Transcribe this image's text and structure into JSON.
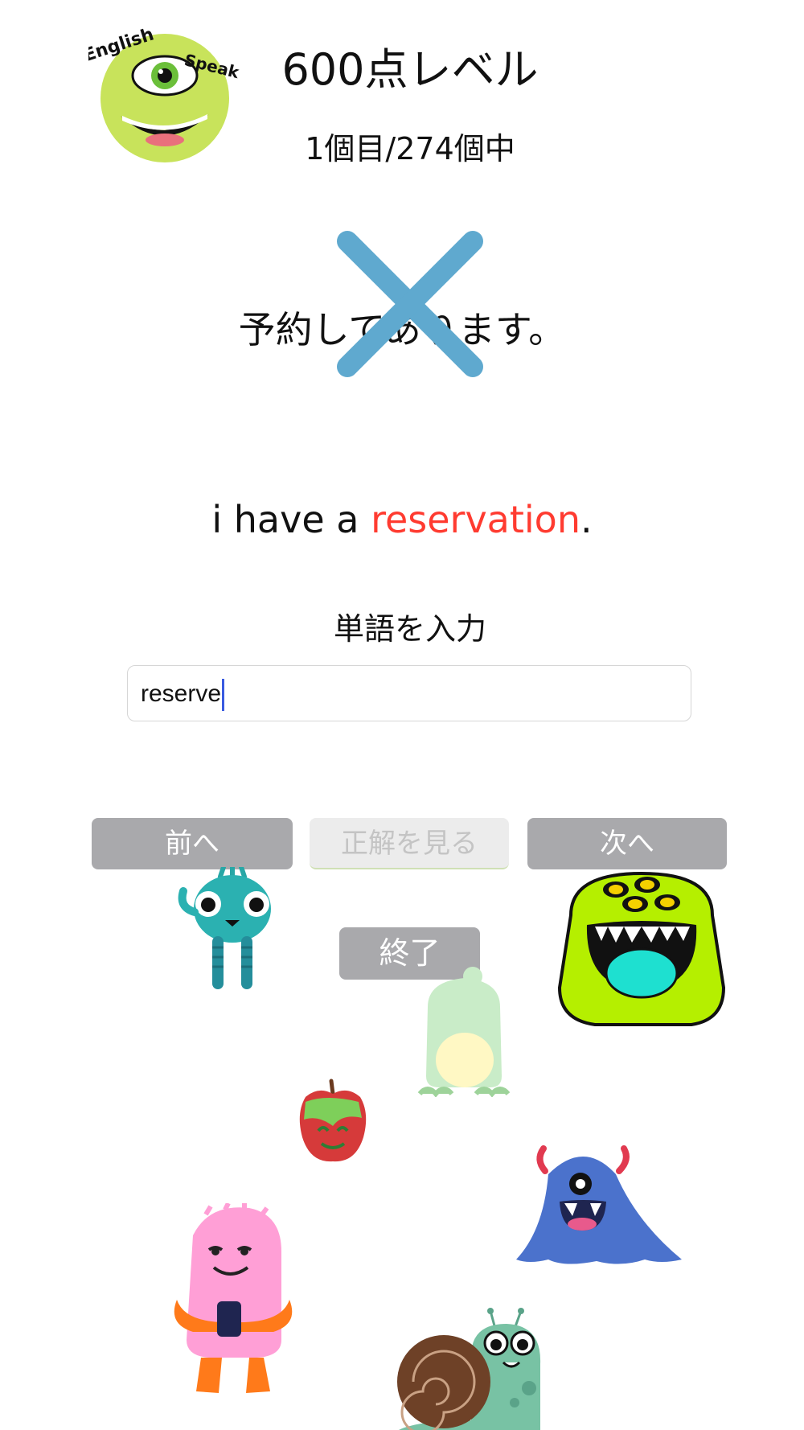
{
  "header": {
    "logo": {
      "text_top": "English",
      "text_right": "Speak"
    },
    "title": "600点レベル",
    "counter": "1個目/274個中"
  },
  "quiz": {
    "japanese_prompt": "予約してあります。",
    "result_mark": "x-icon",
    "sentence_prefix": "i have a ",
    "sentence_answer": "reservation",
    "sentence_suffix": ".",
    "input_label": "単語を入力",
    "input_value": "reserve"
  },
  "buttons": {
    "prev": "前へ",
    "show_answer": "正解を見る",
    "next": "次へ",
    "quit": "終了"
  },
  "colors": {
    "answer_highlight": "#ff3b30",
    "x_mark": "#5fa9cf",
    "button_gray": "#a9a9ac",
    "caret": "#3a5be0"
  },
  "decorations": [
    "teal-monster-icon",
    "lime-monster-icon",
    "frog-icon",
    "poison-apple-icon",
    "blue-monster-icon",
    "pink-monster-icon",
    "snail-icon"
  ]
}
